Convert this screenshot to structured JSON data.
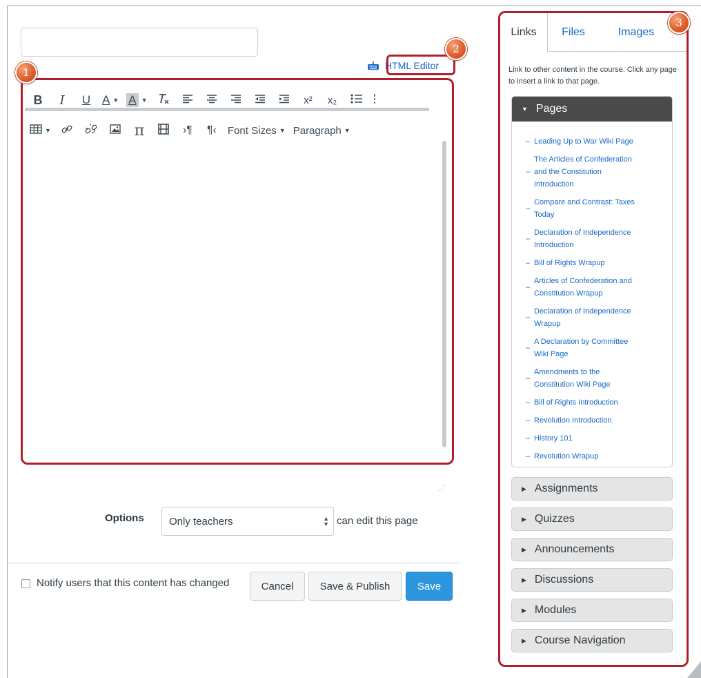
{
  "title_input": {
    "value": "",
    "placeholder": ""
  },
  "html_editor_link": {
    "label": "HTML Editor"
  },
  "badges": [
    "1",
    "2",
    "3"
  ],
  "toolbar": {
    "row1": [
      "B",
      "I",
      "U",
      "A",
      "A",
      "Tx",
      "align-left",
      "align-center",
      "align-right",
      "outdent",
      "indent",
      "x²",
      "x₂",
      "bullet-list"
    ],
    "row2_text": {
      "font_sizes": "Font Sizes",
      "paragraph": "Paragraph"
    }
  },
  "options": {
    "label": "Options",
    "selected": "Only teachers",
    "suffix": "can edit this page"
  },
  "actions": {
    "notify_label": "Notify users that this content has changed",
    "notify_checked": false,
    "cancel": "Cancel",
    "save_publish": "Save & Publish",
    "save": "Save"
  },
  "sidebar": {
    "tabs": [
      "Links",
      "Files",
      "Images"
    ],
    "active_tab": "Links",
    "description": "Link to other content in the course. Click any page to insert a link to that page.",
    "pages_header": "Pages",
    "pages": [
      {
        "lines": [
          "Leading Up to War Wiki Page"
        ]
      },
      {
        "lines": [
          "The Articles of Confederation",
          "and the Constitution",
          "Introduction"
        ]
      },
      {
        "lines": [
          "Compare and Contrast: Taxes",
          "Today"
        ]
      },
      {
        "lines": [
          "Declaration of Independence",
          "Introduction"
        ]
      },
      {
        "lines": [
          "Bill of Rights Wrapup"
        ]
      },
      {
        "lines": [
          "Articles of Confederation and",
          "Constitution Wrapup"
        ]
      },
      {
        "lines": [
          "Declaration of Independence",
          "Wrapup"
        ]
      },
      {
        "lines": [
          "A Declaration by Committee",
          "Wiki Page"
        ]
      },
      {
        "lines": [
          "Amendments to the",
          "Constitution Wiki Page"
        ]
      },
      {
        "lines": [
          "Bill of Rights Introduction"
        ]
      },
      {
        "lines": [
          "Revolution Introduction"
        ]
      },
      {
        "lines": [
          "History 101"
        ]
      },
      {
        "lines": [
          "Revolution Wrapup"
        ]
      }
    ],
    "accordions": [
      "Assignments",
      "Quizzes",
      "Announcements",
      "Discussions",
      "Modules",
      "Course Navigation"
    ]
  },
  "colors": {
    "annotation_red": "#b11e2b",
    "link_blue": "#1769c7",
    "primary_button": "#2d96de",
    "badge_orange": "#e0602f"
  }
}
